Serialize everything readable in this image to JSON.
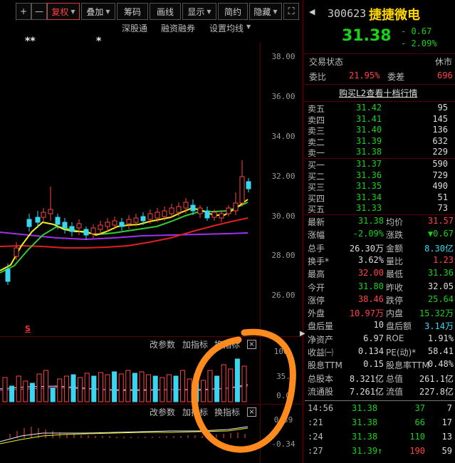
{
  "toolbar": {
    "plus": "+",
    "minus": "—",
    "fuquan": "复权",
    "diejia": "叠加",
    "chouma": "筹码",
    "huaxian": "画线",
    "xianshi": "显示",
    "jianyue": "简约",
    "yincang": "隐藏",
    "expand_glyph": "⛶"
  },
  "chart_links": {
    "shengutong": "深股通",
    "rongzi": "融资融券",
    "junxian": "设置均线"
  },
  "markers": {
    "double_star": "**",
    "single_star": "*",
    "s_marker": "S"
  },
  "price_axis": [
    "38.00",
    "36.00",
    "34.00",
    "32.00",
    "30.00",
    "28.00",
    "26.00"
  ],
  "volume_panel": {
    "params": "改参数",
    "add_indicator": "加指标",
    "switch_indicator": "换指标",
    "close": "×",
    "axis": [
      "100.",
      "35.",
      "0.0"
    ]
  },
  "macd_panel": {
    "params": "改参数",
    "add_indicator": "加指标",
    "switch_indicator": "换指标",
    "close": "×",
    "axis": [
      "0.39",
      "-0.34"
    ]
  },
  "quote": {
    "code": "300623",
    "name": "捷捷微电",
    "price": "31.38",
    "change": "- 0.67",
    "change_pct": "- 2.09%",
    "trade_status_label": "交易状态",
    "trade_status": "休市",
    "weibi_label": "委比",
    "weibi": "21.95%",
    "weicha_label": "委差",
    "weicha": "696",
    "l2_link": "购买L2查看十档行情",
    "asks": [
      {
        "label": "卖五",
        "price": "31.42",
        "vol": "95"
      },
      {
        "label": "卖四",
        "price": "31.41",
        "vol": "145"
      },
      {
        "label": "卖三",
        "price": "31.40",
        "vol": "136"
      },
      {
        "label": "卖二",
        "price": "31.39",
        "vol": "632"
      },
      {
        "label": "卖一",
        "price": "31.38",
        "vol": "229"
      }
    ],
    "bids": [
      {
        "label": "买一",
        "price": "31.37",
        "vol": "590"
      },
      {
        "label": "买二",
        "price": "31.36",
        "vol": "729"
      },
      {
        "label": "买三",
        "price": "31.35",
        "vol": "490"
      },
      {
        "label": "买四",
        "price": "31.34",
        "vol": "51"
      },
      {
        "label": "买五",
        "price": "31.33",
        "vol": "73"
      }
    ],
    "stats": [
      {
        "l1": "最新",
        "v1": "31.38",
        "c1": "green",
        "l2": "均价",
        "v2": "31.57",
        "c2": "red"
      },
      {
        "l1": "涨幅",
        "v1": "-2.09%",
        "c1": "green",
        "l2": "涨跌",
        "v2": "▼0.67",
        "c2": "green"
      },
      {
        "l1": "总手",
        "v1": "26.30万",
        "c1": "white",
        "l2": "金额",
        "v2": "8.30亿",
        "c2": "cyan"
      },
      {
        "l1": "换手*",
        "v1": "3.62%",
        "c1": "white",
        "l2": "量比",
        "v2": "1.23",
        "c2": "red"
      },
      {
        "l1": "最高",
        "v1": "32.00",
        "c1": "red",
        "l2": "最低",
        "v2": "31.36",
        "c2": "green"
      },
      {
        "l1": "今开",
        "v1": "31.80",
        "c1": "green",
        "l2": "昨收",
        "v2": "32.05",
        "c2": "white"
      },
      {
        "l1": "涨停",
        "v1": "38.46",
        "c1": "red",
        "l2": "跌停",
        "v2": "25.64",
        "c2": "green"
      },
      {
        "l1": "外盘",
        "v1": "10.97万",
        "c1": "red",
        "l2": "内盘",
        "v2": "15.32万",
        "c2": "green"
      },
      {
        "l1": "盘后量",
        "v1": "10",
        "c1": "white",
        "l2": "盘后额",
        "v2": "3.14万",
        "c2": "cyan"
      },
      {
        "l1": "净资产",
        "v1": "6.97",
        "c1": "white",
        "l2": "ROE",
        "v2": "1.91%",
        "c2": "white"
      },
      {
        "l1": "收益㈠",
        "v1": "0.134",
        "c1": "white",
        "l2": "PE(动)*",
        "v2": "58.41",
        "c2": "white"
      },
      {
        "l1": "股息TTM",
        "v1": "0.15",
        "c1": "white",
        "l2": "股息率TTM",
        "v2": "0.48%",
        "c2": "white"
      },
      {
        "l1": "总股本",
        "v1": "8.321亿",
        "c1": "white",
        "l2": "总值",
        "v2": "261.1亿",
        "c2": "white"
      },
      {
        "l1": "流通股",
        "v1": "7.261亿",
        "c1": "white",
        "l2": "流值",
        "v2": "227.8亿",
        "c2": "white"
      }
    ],
    "ticks": [
      {
        "time": "14:56",
        "price": "31.38",
        "pc": "green",
        "vol": "37",
        "vc": "green",
        "n": "7"
      },
      {
        "time": ":21",
        "price": "31.38",
        "pc": "green",
        "vol": "66",
        "vc": "green",
        "n": "17"
      },
      {
        "time": ":24",
        "price": "31.38",
        "pc": "green",
        "vol": "110",
        "vc": "green",
        "n": "13"
      },
      {
        "time": ":27",
        "price": "31.39↑",
        "pc": "green",
        "vol": "190",
        "vc": "red",
        "n": "59"
      }
    ]
  },
  "colors": {
    "up": "#ff4444",
    "down": "#19d119",
    "cyan": "#3ad6f0",
    "ma5": "#f0f020",
    "ma10": "#33cc33",
    "ma20": "#e02020",
    "ma60": "#a030f0",
    "annotation": "#ff8a1e"
  }
}
